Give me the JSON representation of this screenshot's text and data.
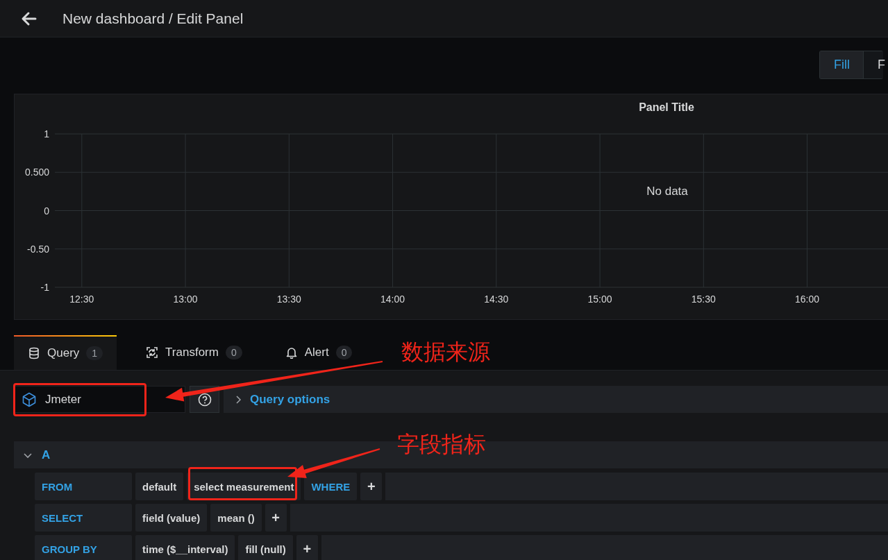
{
  "header": {
    "title": "New dashboard / Edit Panel"
  },
  "view_modes": [
    {
      "label": "Fill",
      "selected": true
    },
    {
      "label": "F",
      "selected": false
    }
  ],
  "panel": {
    "title": "Panel Title",
    "message": "No data",
    "chart_data": {
      "type": "line",
      "grid": true,
      "xlim": [
        12.37,
        16.39
      ],
      "ylim": [
        -1,
        1
      ],
      "yticks": [
        1,
        {
          "value": 0.5,
          "label": "0.500"
        },
        0,
        {
          "value": -0.5,
          "label": "-0.50"
        },
        -1
      ],
      "xticks": [
        {
          "value": 12.5,
          "label": "12:30"
        },
        {
          "value": 13,
          "label": "13:00"
        },
        {
          "value": 13.5,
          "label": "13:30"
        },
        {
          "value": 14,
          "label": "14:00"
        },
        {
          "value": 14.5,
          "label": "14:30"
        },
        {
          "value": 15,
          "label": "15:00"
        },
        {
          "value": 15.5,
          "label": "15:30"
        },
        {
          "value": 16,
          "label": "16:00"
        }
      ]
    }
  },
  "tabs": [
    {
      "label": "Query",
      "count": "1",
      "selected": true
    },
    {
      "label": "Transform",
      "count": "0",
      "selected": false
    },
    {
      "label": "Alert",
      "count": "0",
      "selected": false
    }
  ],
  "datasource": {
    "name": "Jmeter",
    "highlighted": true
  },
  "query_options": {
    "label": "Query options",
    "expanded": false
  },
  "query": {
    "ref": "A",
    "expanded": true,
    "rows": [
      {
        "label": "FROM",
        "segments": [
          {
            "kind": "value",
            "text": "default",
            "highlighted": false
          },
          {
            "kind": "value",
            "text": "select measurement",
            "highlighted": true
          },
          {
            "kind": "keyword",
            "text": "WHERE",
            "highlighted": false
          },
          {
            "kind": "add",
            "text": "+",
            "highlighted": false
          }
        ]
      },
      {
        "label": "SELECT",
        "segments": [
          {
            "kind": "value",
            "text": "field (value)",
            "highlighted": false
          },
          {
            "kind": "value",
            "text": "mean ()",
            "highlighted": false
          },
          {
            "kind": "add",
            "text": "+",
            "highlighted": false
          }
        ]
      },
      {
        "label": "GROUP BY",
        "segments": [
          {
            "kind": "value",
            "text": "time ($__interval)",
            "highlighted": false
          },
          {
            "kind": "value",
            "text": "fill (null)",
            "highlighted": false
          },
          {
            "kind": "add",
            "text": "+",
            "highlighted": false
          }
        ]
      }
    ]
  },
  "callouts": [
    {
      "text": "数据来源"
    },
    {
      "text": "字段指标"
    }
  ]
}
